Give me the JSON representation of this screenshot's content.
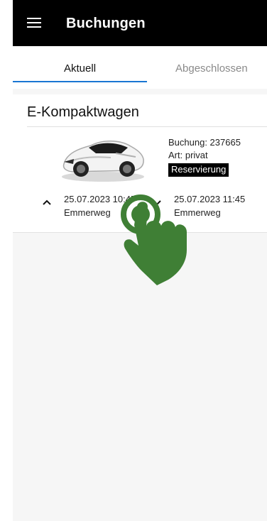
{
  "app_bar": {
    "title": "Buchungen",
    "menu_icon": "hamburger-menu-icon"
  },
  "tabs": [
    {
      "label": "Aktuell",
      "active": true
    },
    {
      "label": "Abgeschlossen",
      "active": false
    }
  ],
  "booking_card": {
    "car_class": "E-Kompaktwagen",
    "booking_number_label": "Buchung: 237665",
    "type_label": "Art: privat",
    "status_badge": "Reservierung",
    "start": {
      "datetime": "25.07.2023 10:45",
      "location": "Emmerweg"
    },
    "end": {
      "datetime": "25.07.2023 11:45",
      "location": "Emmerweg"
    }
  },
  "colors": {
    "app_bar_bg": "#000000",
    "tab_indicator": "#1976d2",
    "inactive_tab_text": "#8a8a8a",
    "tap_hint": "#3f7f35"
  }
}
